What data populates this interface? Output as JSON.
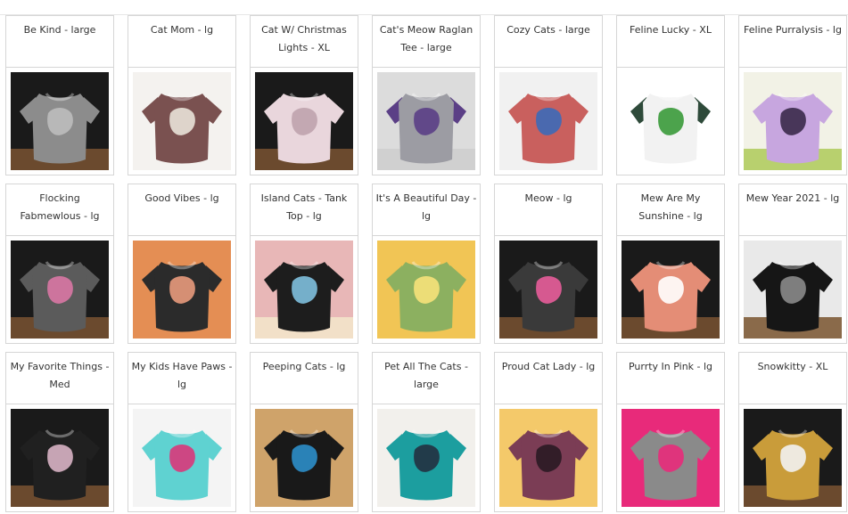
{
  "products": [
    {
      "title": "Be Kind - large",
      "icon": "gray-tshirt-photo",
      "image": {
        "bg": "#1a1a1a",
        "floor": "#6b4a2e",
        "shirt": "#8c8c8c",
        "sleeve": "#8c8c8c",
        "print": "#bcbcbc"
      }
    },
    {
      "title": "Cat Mom - lg",
      "icon": "brown-tshirt-photo",
      "image": {
        "bg": "#f4f2ef",
        "floor": "#f4f2ef",
        "shirt": "#7a5150",
        "sleeve": "#7a5150",
        "print": "#e9e2d8"
      }
    },
    {
      "title": "Cat W/ Christmas Lights - XL",
      "icon": "pink-tshirt-photo",
      "image": {
        "bg": "#1a1a1a",
        "floor": "#6b4a2e",
        "shirt": "#e9d6dc",
        "sleeve": "#e9d6dc",
        "print": "#bfa3ad"
      }
    },
    {
      "title": "Cat's Meow Raglan Tee - large",
      "icon": "raglan-tshirt-photo",
      "image": {
        "bg": "#dcdcdc",
        "floor": "#d0d0d0",
        "shirt": "#9c9ca3",
        "sleeve": "#5b3f86",
        "print": "#5b3f86"
      }
    },
    {
      "title": "Cozy Cats - large",
      "icon": "red-tshirt-photo",
      "image": {
        "bg": "#f1f1f1",
        "floor": "#f1f1f1",
        "shirt": "#c9605e",
        "sleeve": "#c9605e",
        "print": "#3c6ab8"
      }
    },
    {
      "title": "Feline Lucky - XL",
      "icon": "baseball-tshirt-photo",
      "image": {
        "bg": "#ffffff",
        "floor": "#ffffff",
        "shirt": "#f2f2f2",
        "sleeve": "#2e4a3a",
        "print": "#3a9a3a"
      }
    },
    {
      "title": "Feline Purralysis - lg",
      "icon": "lavender-tshirt-photo",
      "image": {
        "bg": "#f2f2e6",
        "floor": "#b8d06e",
        "shirt": "#c7a6df",
        "sleeve": "#c7a6df",
        "print": "#3a2a4a"
      }
    },
    {
      "title": "Flocking Fabmewlous - lg",
      "icon": "heather-tshirt-photo",
      "image": {
        "bg": "#1a1a1a",
        "floor": "#6b4a2e",
        "shirt": "#5b5b5b",
        "sleeve": "#5b5b5b",
        "print": "#d977a4"
      }
    },
    {
      "title": "Good Vibes - lg",
      "icon": "black-tshirt-photo",
      "image": {
        "bg": "#e48e54",
        "floor": "#e48e54",
        "shirt": "#2b2b2b",
        "sleeve": "#2b2b2b",
        "print": "#e89a7c"
      }
    },
    {
      "title": "Island Cats - Tank Top - lg",
      "icon": "tank-top-photo",
      "image": {
        "bg": "#e8b7b7",
        "floor": "#f2e0c8",
        "shirt": "#1d1d1d",
        "sleeve": "#1d1d1d",
        "print": "#7fc0de"
      }
    },
    {
      "title": "It's A Beautiful Day - lg",
      "icon": "green-tshirt-photo",
      "image": {
        "bg": "#f1c555",
        "floor": "#f1c555",
        "shirt": "#8cb060",
        "sleeve": "#8cb060",
        "print": "#f6e27a"
      }
    },
    {
      "title": "Meow - lg",
      "icon": "black-meow-tshirt-photo",
      "image": {
        "bg": "#1a1a1a",
        "floor": "#6b4a2e",
        "shirt": "#3a3a3a",
        "sleeve": "#3a3a3a",
        "print": "#e85d9a"
      }
    },
    {
      "title": "Mew Are My Sunshine - lg",
      "icon": "orange-tshirt-photo",
      "image": {
        "bg": "#1a1a1a",
        "floor": "#6b4a2e",
        "shirt": "#e48d76",
        "sleeve": "#e48d76",
        "print": "#ffffff"
      }
    },
    {
      "title": "Mew Year 2021 - lg",
      "icon": "black-shirt-photo",
      "image": {
        "bg": "#e9e9e9",
        "floor": "#8a6a4a",
        "shirt": "#161616",
        "sleeve": "#161616",
        "print": "#8a8a8a"
      }
    },
    {
      "title": "My Favorite Things - Med",
      "icon": "black-longsleeve-photo",
      "image": {
        "bg": "#1a1a1a",
        "floor": "#6b4a2e",
        "shirt": "#202020",
        "sleeve": "#202020",
        "print": "#d8b3c4"
      }
    },
    {
      "title": "My Kids Have Paws - lg",
      "icon": "aqua-tshirt-photo",
      "image": {
        "bg": "#f4f4f4",
        "floor": "#f4f4f4",
        "shirt": "#5fd2d1",
        "sleeve": "#5fd2d1",
        "print": "#d9377a"
      }
    },
    {
      "title": "Peeping Cats - lg",
      "icon": "black-peeping-tshirt-photo",
      "image": {
        "bg": "#cfa36a",
        "floor": "#cfa36a",
        "shirt": "#191919",
        "sleeve": "#191919",
        "print": "#2c8ec9"
      }
    },
    {
      "title": "Pet All The Cats - large",
      "icon": "teal-tshirt-photo",
      "image": {
        "bg": "#f2f0ec",
        "floor": "#f2f0ec",
        "shirt": "#1c9e9f",
        "sleeve": "#1c9e9f",
        "print": "#243040"
      }
    },
    {
      "title": "Proud Cat Lady - lg",
      "icon": "model-tshirt-photo",
      "image": {
        "bg": "#f4c96a",
        "floor": "#f4c96a",
        "shirt": "#7b3d55",
        "sleeve": "#7b3d55",
        "print": "#2a1a24"
      }
    },
    {
      "title": "Purrty In Pink - lg",
      "icon": "gray-pink-tshirt-photo",
      "image": {
        "bg": "#e82a7a",
        "floor": "#e82a7a",
        "shirt": "#8a8a8a",
        "sleeve": "#8a8a8a",
        "print": "#e82a7a"
      }
    },
    {
      "title": "Snowkitty - XL",
      "icon": "mustard-tshirt-photo",
      "image": {
        "bg": "#1a1a1a",
        "floor": "#6b4a2e",
        "shirt": "#c99c3a",
        "sleeve": "#c99c3a",
        "print": "#f2f2f2"
      }
    }
  ]
}
